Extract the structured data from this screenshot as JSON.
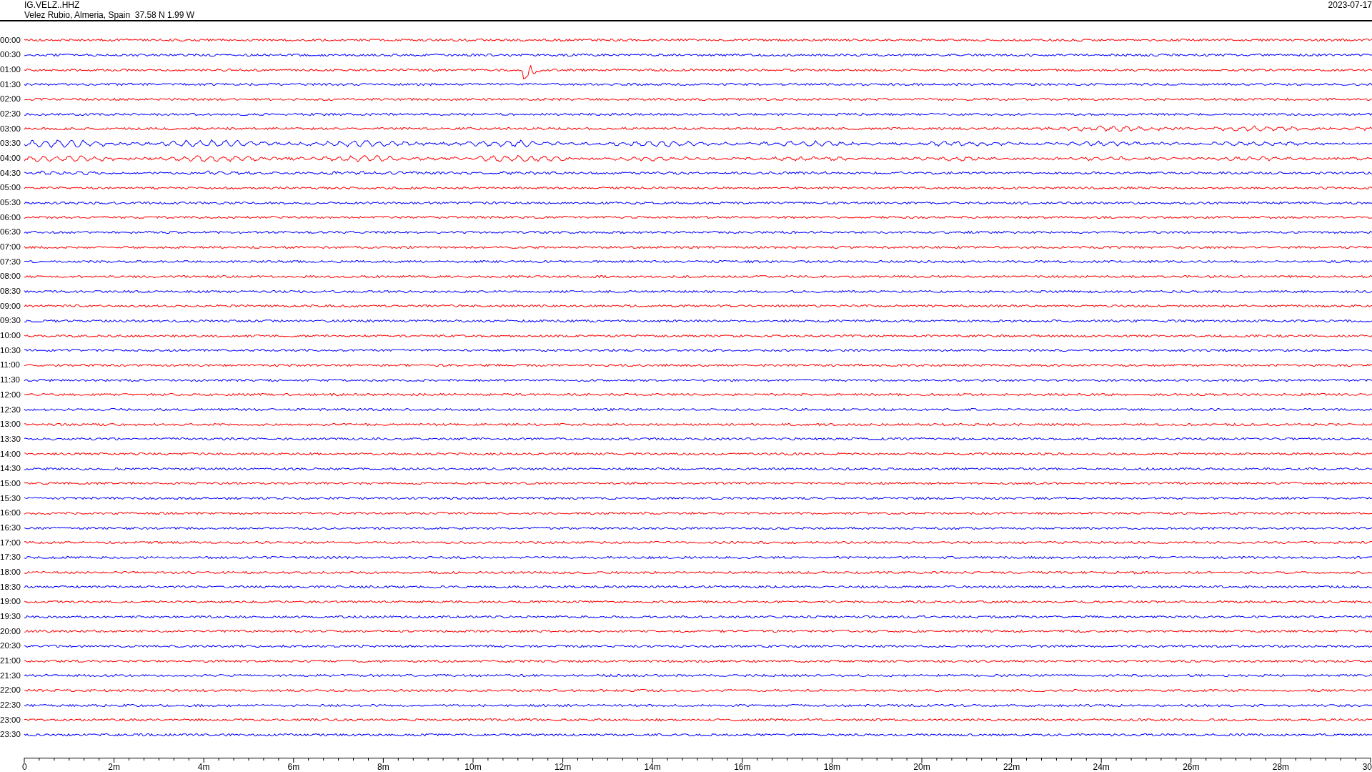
{
  "header": {
    "station": "IG.VELZ..HHZ",
    "location": "Velez Rubio, Almeria, Spain  37.58 N 1.99 W",
    "date": "2023-07-17"
  },
  "rows": [
    {
      "time": "00:00",
      "color": "#ff0000",
      "kind": "noise"
    },
    {
      "time": "00:30",
      "color": "#0000ff",
      "kind": "noise"
    },
    {
      "time": "01:00",
      "color": "#ff0000",
      "kind": "event"
    },
    {
      "time": "01:30",
      "color": "#0000ff",
      "kind": "noise"
    },
    {
      "time": "02:00",
      "color": "#ff0000",
      "kind": "noise"
    },
    {
      "time": "02:30",
      "color": "#0000ff",
      "kind": "noise"
    },
    {
      "time": "03:00",
      "color": "#ff0000",
      "kind": "waves"
    },
    {
      "time": "03:30",
      "color": "#0000ff",
      "kind": "waves"
    },
    {
      "time": "04:00",
      "color": "#ff0000",
      "kind": "waves"
    },
    {
      "time": "04:30",
      "color": "#0000ff",
      "kind": "waves"
    },
    {
      "time": "05:00",
      "color": "#ff0000",
      "kind": "noise"
    },
    {
      "time": "05:30",
      "color": "#0000ff",
      "kind": "noise"
    },
    {
      "time": "06:00",
      "color": "#ff0000",
      "kind": "noise"
    },
    {
      "time": "06:30",
      "color": "#0000ff",
      "kind": "noise"
    },
    {
      "time": "07:00",
      "color": "#ff0000",
      "kind": "noise"
    },
    {
      "time": "07:30",
      "color": "#0000ff",
      "kind": "noise"
    },
    {
      "time": "08:00",
      "color": "#ff0000",
      "kind": "noise"
    },
    {
      "time": "08:30",
      "color": "#0000ff",
      "kind": "noise"
    },
    {
      "time": "09:00",
      "color": "#ff0000",
      "kind": "noise"
    },
    {
      "time": "09:30",
      "color": "#0000ff",
      "kind": "noise"
    },
    {
      "time": "10:00",
      "color": "#ff0000",
      "kind": "noise"
    },
    {
      "time": "10:30",
      "color": "#0000ff",
      "kind": "noise"
    },
    {
      "time": "11:00",
      "color": "#ff0000",
      "kind": "noise"
    },
    {
      "time": "11:30",
      "color": "#0000ff",
      "kind": "noise"
    },
    {
      "time": "12:00",
      "color": "#ff0000",
      "kind": "noise"
    },
    {
      "time": "12:30",
      "color": "#0000ff",
      "kind": "noise"
    },
    {
      "time": "13:00",
      "color": "#ff0000",
      "kind": "noise"
    },
    {
      "time": "13:30",
      "color": "#0000ff",
      "kind": "noise"
    },
    {
      "time": "14:00",
      "color": "#ff0000",
      "kind": "noise"
    },
    {
      "time": "14:30",
      "color": "#0000ff",
      "kind": "noise"
    },
    {
      "time": "15:00",
      "color": "#ff0000",
      "kind": "noise"
    },
    {
      "time": "15:30",
      "color": "#0000ff",
      "kind": "noise"
    },
    {
      "time": "16:00",
      "color": "#ff0000",
      "kind": "noise"
    },
    {
      "time": "16:30",
      "color": "#0000ff",
      "kind": "noise"
    },
    {
      "time": "17:00",
      "color": "#ff0000",
      "kind": "noise"
    },
    {
      "time": "17:30",
      "color": "#0000ff",
      "kind": "noise"
    },
    {
      "time": "18:00",
      "color": "#ff0000",
      "kind": "noise"
    },
    {
      "time": "18:30",
      "color": "#0000ff",
      "kind": "noise"
    },
    {
      "time": "19:00",
      "color": "#ff0000",
      "kind": "noise"
    },
    {
      "time": "19:30",
      "color": "#0000ff",
      "kind": "noise"
    },
    {
      "time": "20:00",
      "color": "#ff0000",
      "kind": "noise"
    },
    {
      "time": "20:30",
      "color": "#0000ff",
      "kind": "noise"
    },
    {
      "time": "21:00",
      "color": "#ff0000",
      "kind": "noise"
    },
    {
      "time": "21:30",
      "color": "#0000ff",
      "kind": "noise"
    },
    {
      "time": "22:00",
      "color": "#ff0000",
      "kind": "noise"
    },
    {
      "time": "22:30",
      "color": "#0000ff",
      "kind": "noise"
    },
    {
      "time": "23:00",
      "color": "#ff0000",
      "kind": "noise"
    },
    {
      "time": "23:30",
      "color": "#0000ff",
      "kind": "noise"
    }
  ],
  "axis": {
    "labels": [
      "0",
      "2m",
      "4m",
      "6m",
      "8m",
      "10m",
      "12m",
      "14m",
      "16m",
      "18m",
      "20m",
      "22m",
      "24m",
      "26m",
      "28m",
      "30"
    ]
  }
}
